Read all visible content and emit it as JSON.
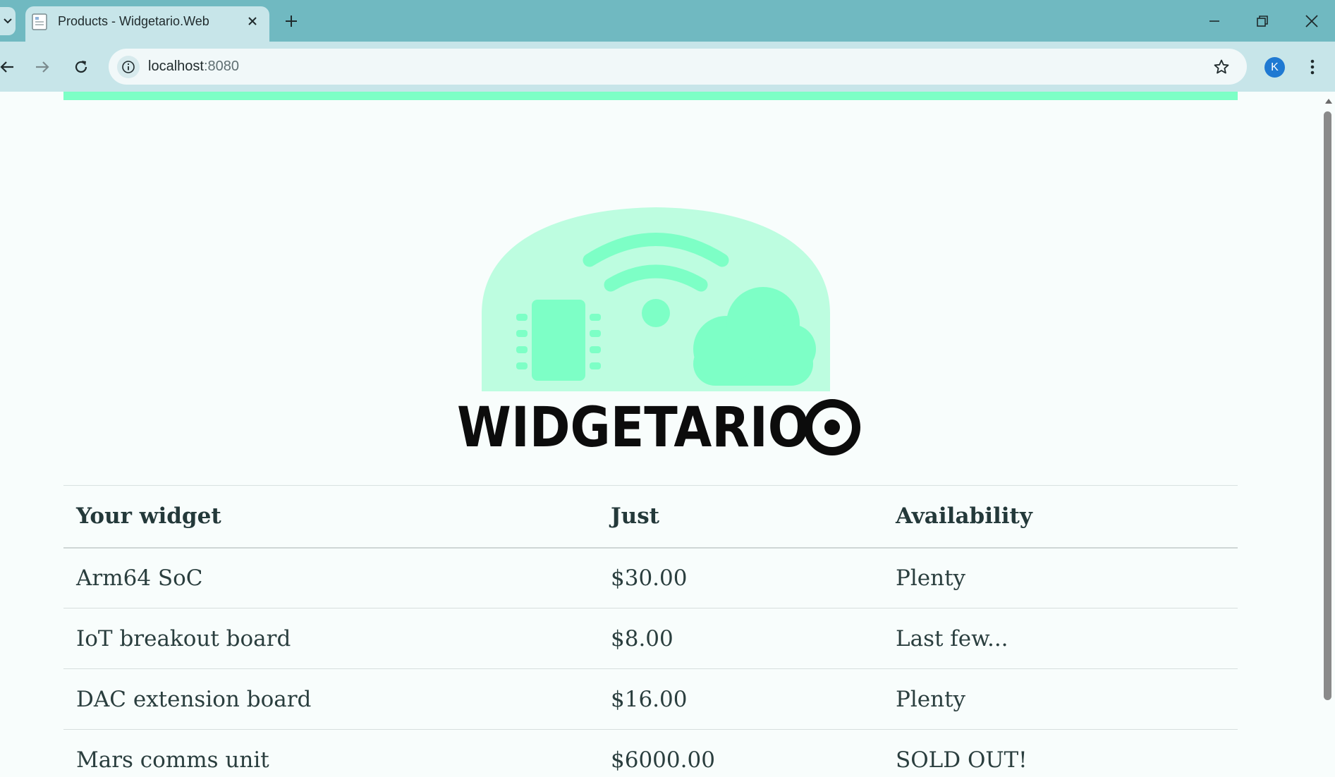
{
  "browser": {
    "tab_title": "Products - Widgetario.Web",
    "url_host": "localhost",
    "url_port": ":8080",
    "profile_initial": "K"
  },
  "page": {
    "logo_text": "WIDGETARIO",
    "table": {
      "headers": [
        "Your widget",
        "Just",
        "Availability"
      ],
      "rows": [
        {
          "name": "Arm64 SoC",
          "price": "$30.00",
          "availability": "Plenty"
        },
        {
          "name": "IoT breakout board",
          "price": "$8.00",
          "availability": "Last few..."
        },
        {
          "name": "DAC extension board",
          "price": "$16.00",
          "availability": "Plenty"
        },
        {
          "name": "Mars comms unit",
          "price": "$6000.00",
          "availability": "SOLD OUT!"
        }
      ]
    }
  },
  "colors": {
    "tabstrip": "#70b9c1",
    "toolbar": "#c7e5e9",
    "accent": "#7dffc6",
    "logo_light": "#bdfde0",
    "logo_mid": "#7dffc6"
  }
}
